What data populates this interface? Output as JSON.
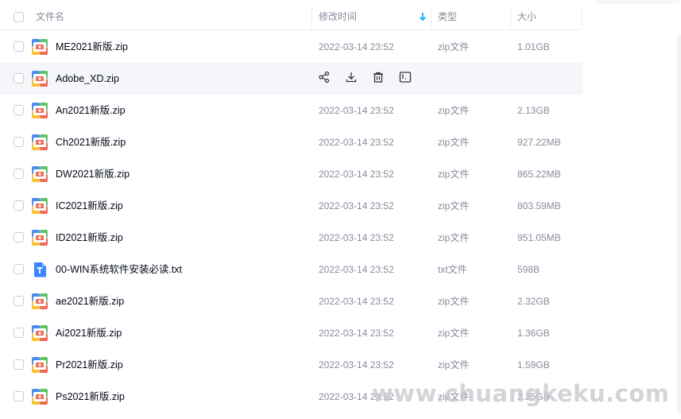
{
  "header": {
    "name_label": "文件名",
    "time_label": "修改时间",
    "type_label": "类型",
    "size_label": "大小",
    "sort_icon": "arrow-down-icon"
  },
  "rows": [
    {
      "name": "ME2021新版.zip",
      "time": "2022-03-14 23:52",
      "type": "zip文件",
      "size": "1.01GB",
      "icon": "zip-archive-icon"
    },
    {
      "name": "Adobe_XD.zip",
      "time": "",
      "type": "",
      "size": "",
      "icon": "zip-archive-icon",
      "hovered": true,
      "actions": [
        "share-icon",
        "download-icon",
        "delete-icon",
        "more-icon"
      ]
    },
    {
      "name": "An2021新版.zip",
      "time": "2022-03-14 23:52",
      "type": "zip文件",
      "size": "2.13GB",
      "icon": "zip-archive-icon"
    },
    {
      "name": "Ch2021新版.zip",
      "time": "2022-03-14 23:52",
      "type": "zip文件",
      "size": "927.22MB",
      "icon": "zip-archive-icon"
    },
    {
      "name": "DW2021新版.zip",
      "time": "2022-03-14 23:52",
      "type": "zip文件",
      "size": "865.22MB",
      "icon": "zip-archive-icon"
    },
    {
      "name": "IC2021新版.zip",
      "time": "2022-03-14 23:52",
      "type": "zip文件",
      "size": "803.59MB",
      "icon": "zip-archive-icon"
    },
    {
      "name": "ID2021新版.zip",
      "time": "2022-03-14 23:52",
      "type": "zip文件",
      "size": "951.05MB",
      "icon": "zip-archive-icon"
    },
    {
      "name": "00-WIN系统软件安装必读.txt",
      "time": "2022-03-14 23:52",
      "type": "txt文件",
      "size": "598B",
      "icon": "text-file-icon"
    },
    {
      "name": "ae2021新版.zip",
      "time": "2022-03-14 23:52",
      "type": "zip文件",
      "size": "2.32GB",
      "icon": "zip-archive-icon"
    },
    {
      "name": "Ai2021新版.zip",
      "time": "2022-03-14 23:52",
      "type": "zip文件",
      "size": "1.36GB",
      "icon": "zip-archive-icon"
    },
    {
      "name": "Pr2021新版.zip",
      "time": "2022-03-14 23:52",
      "type": "zip文件",
      "size": "1.59GB",
      "icon": "zip-archive-icon"
    },
    {
      "name": "Ps2021新版.zip",
      "time": "2022-03-14 23:52",
      "type": "zip文件",
      "size": "2.35GB",
      "icon": "zip-archive-icon"
    }
  ],
  "watermark": "www.chuangkeku.com",
  "colors": {
    "accent": "#06a7ff",
    "zip_blue": "#4a8cf0",
    "zip_green": "#63c06b",
    "zip_yellow": "#f8c233",
    "zip_red": "#f06a55",
    "txt_blue": "#3b86ff"
  }
}
